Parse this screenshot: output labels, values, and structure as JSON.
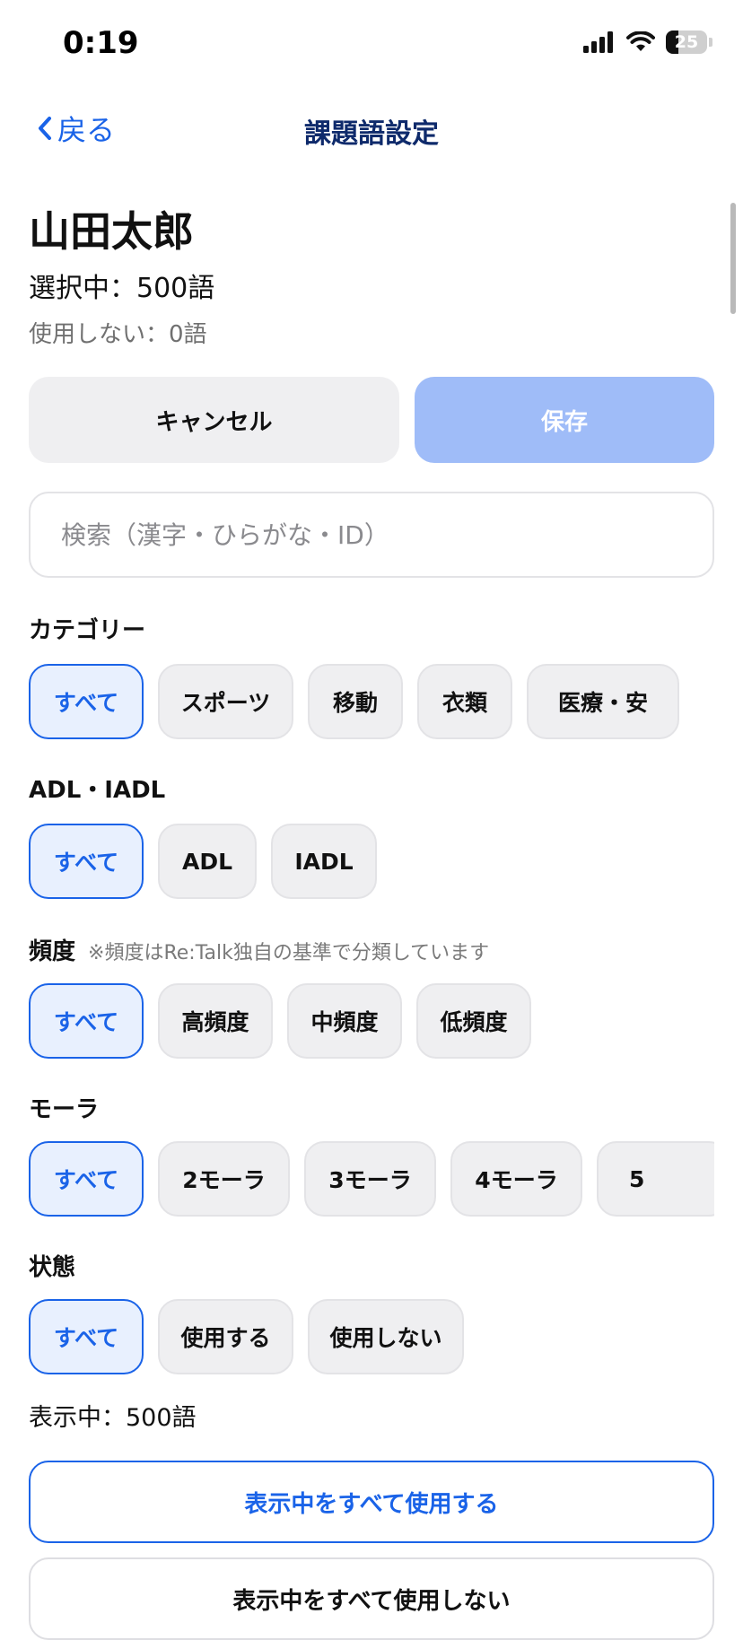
{
  "status_bar": {
    "time": "0:19",
    "battery": "25"
  },
  "nav": {
    "back_label": "戻る",
    "title": "課題語設定"
  },
  "user": {
    "name": "山田太郎",
    "selected": "選択中：500語",
    "unused": "使用しない：0語"
  },
  "actions": {
    "cancel": "キャンセル",
    "save": "保存"
  },
  "search": {
    "placeholder": "検索（漢字・ひらがな・ID）"
  },
  "filters": {
    "category": {
      "label": "カテゴリー",
      "options": [
        "すべて",
        "スポーツ",
        "移動",
        "衣類",
        "医療・安"
      ]
    },
    "adl": {
      "label": "ADL・IADL",
      "options": [
        "すべて",
        "ADL",
        "IADL"
      ]
    },
    "frequency": {
      "label": "頻度",
      "note": "※頻度はRe:Talk独自の基準で分類しています",
      "options": [
        "すべて",
        "高頻度",
        "中頻度",
        "低頻度"
      ]
    },
    "mora": {
      "label": "モーラ",
      "options": [
        "すべて",
        "2モーラ",
        "3モーラ",
        "4モーラ",
        "5"
      ]
    },
    "state": {
      "label": "状態",
      "options": [
        "すべて",
        "使用する",
        "使用しない"
      ]
    }
  },
  "showing": "表示中：500語",
  "bulk": {
    "use_all": "表示中をすべて使用する",
    "unuse_all": "表示中をすべて使用しない"
  },
  "colors": {
    "accent": "#1a63e8",
    "save_disabled": "#9fbcf8",
    "title": "#0e2a6b"
  }
}
